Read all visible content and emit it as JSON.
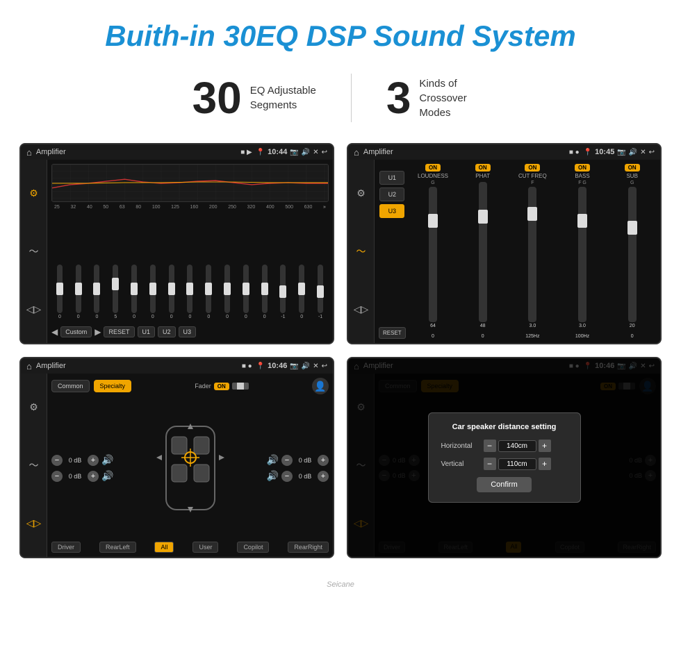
{
  "page": {
    "title": "Buith-in 30EQ DSP Sound System",
    "stat1_number": "30",
    "stat1_label": "EQ Adjustable\nSegments",
    "stat2_number": "3",
    "stat2_label": "Kinds of\nCrossover Modes",
    "watermark": "Seicane"
  },
  "screen1": {
    "title": "Amplifier",
    "time": "10:44",
    "freq_labels": [
      "25",
      "32",
      "40",
      "50",
      "63",
      "80",
      "100",
      "125",
      "160",
      "200",
      "250",
      "320",
      "400",
      "500",
      "630"
    ],
    "slider_values": [
      "0",
      "0",
      "0",
      "5",
      "0",
      "0",
      "0",
      "0",
      "0",
      "0",
      "0",
      "0",
      "-1",
      "0",
      "-1"
    ],
    "bottom_buttons": [
      "Custom",
      "RESET",
      "U1",
      "U2",
      "U3"
    ]
  },
  "screen2": {
    "title": "Amplifier",
    "time": "10:45",
    "presets": [
      "U1",
      "U2",
      "U3"
    ],
    "active_preset": "U3",
    "channels": [
      {
        "name": "LOUDNESS",
        "toggle": "ON"
      },
      {
        "name": "PHAT",
        "toggle": "ON"
      },
      {
        "name": "CUT FREQ",
        "toggle": "ON"
      },
      {
        "name": "BASS",
        "toggle": "ON"
      },
      {
        "name": "SUB",
        "toggle": "ON"
      }
    ],
    "reset_label": "RESET"
  },
  "screen3": {
    "title": "Amplifier",
    "time": "10:46",
    "common_label": "Common",
    "specialty_label": "Specialty",
    "fader_label": "Fader",
    "fader_toggle": "ON",
    "vol_left_top": "0 dB",
    "vol_left_bottom": "0 dB",
    "vol_right_top": "0 dB",
    "vol_right_bottom": "0 dB",
    "positions": [
      "Driver",
      "RearLeft",
      "All",
      "User",
      "Copilot",
      "RearRight"
    ],
    "active_position": "All"
  },
  "screen4": {
    "title": "Amplifier",
    "time": "10:46",
    "common_label": "Common",
    "specialty_label": "Specialty",
    "fader_toggle": "ON",
    "modal": {
      "title": "Car speaker distance setting",
      "horizontal_label": "Horizontal",
      "horizontal_value": "140cm",
      "vertical_label": "Vertical",
      "vertical_value": "110cm",
      "confirm_label": "Confirm"
    },
    "vol_right_top": "0 dB",
    "vol_right_bottom": "0 dB",
    "positions": [
      "Driver",
      "RearLeft",
      "All",
      "Copilot",
      "RearRight"
    ]
  }
}
